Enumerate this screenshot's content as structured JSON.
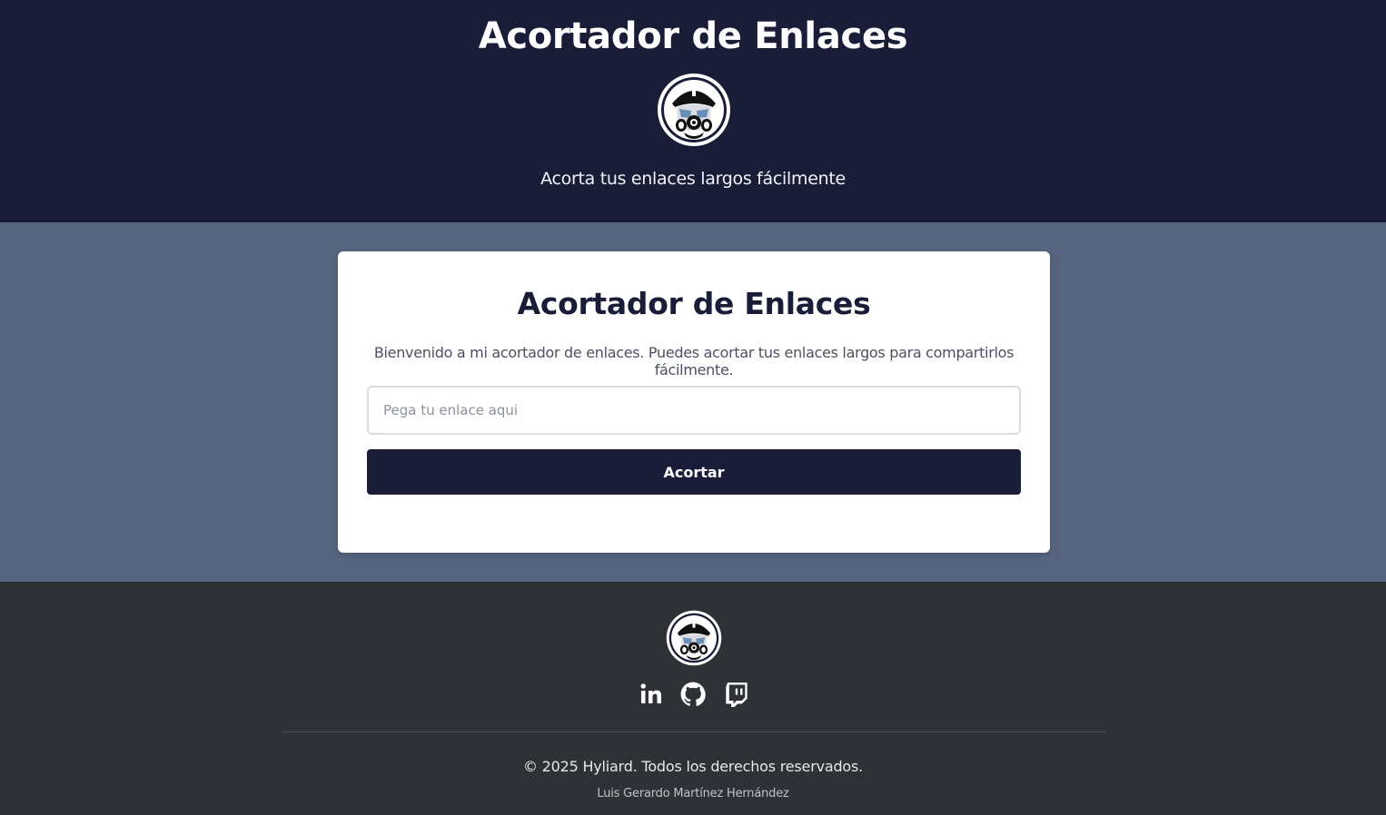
{
  "header": {
    "title": "Acortador de Enlaces",
    "logo": "gas-mask-avatar-logo",
    "subtitle": "Acorta tus enlaces largos fácilmente"
  },
  "card": {
    "title": "Acortador de Enlaces",
    "description": "Bienvenido a mi acortador de enlaces. Puedes acortar tus enlaces largos para compartirlos fácilmente.",
    "input": {
      "placeholder": "Pega tu enlace aqui",
      "value": ""
    },
    "button_label": "Acortar"
  },
  "footer": {
    "logo": "gas-mask-avatar-logo",
    "socials": [
      {
        "icon": "linkedin-icon"
      },
      {
        "icon": "github-icon"
      },
      {
        "icon": "twitch-icon"
      }
    ],
    "copyright": "© 2025 Hyliard. Todos los derechos reservados.",
    "author": "Luis Gerardo Martínez Hernández"
  },
  "colors": {
    "header_bg": "#1a1d38",
    "main_bg": "#56647f",
    "footer_bg": "#2e3236",
    "button_bg": "#1a1d38"
  }
}
